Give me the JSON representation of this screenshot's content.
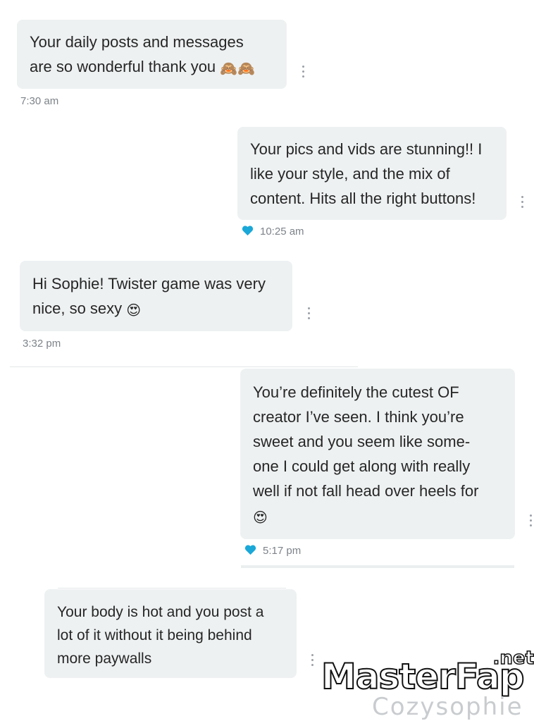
{
  "messages": [
    {
      "id": "m1",
      "direction": "incoming",
      "text": "Your daily posts and messages\nare so wonderful thank you",
      "emoji": "🙈🙈",
      "time": "7:30 am"
    },
    {
      "id": "m2",
      "direction": "outgoing",
      "text": "Your pics and vids are stunning!! I\nlike your style, and the mix of\ncontent. Hits all the right buttons!",
      "emoji": "",
      "time": "10:25 am",
      "liked": true
    },
    {
      "id": "m3",
      "direction": "incoming",
      "text": "Hi Sophie! Twister game was very\nnice, so sexy",
      "emoji": "😍",
      "time": "3:32 pm"
    },
    {
      "id": "m4",
      "direction": "outgoing",
      "text": "You’re definitely the cutest OF\ncreator I’ve seen. I think you’re\nsweet and you seem like some-\none I could get along with really\nwell if not fall head over heels for",
      "emoji": "😍",
      "time": "5:17 pm",
      "liked": true
    },
    {
      "id": "m5",
      "direction": "incoming",
      "text": "Your body is hot and you post a\nlot of it without it being behind\nmore paywalls",
      "emoji": "",
      "time": ""
    }
  ],
  "watermark": {
    "brand_a": "Master",
    "brand_b": "Fap",
    "tld": ".net",
    "sub": "Cozysophie"
  },
  "colors": {
    "bubble": "#eef1f2",
    "time": "#7d8389",
    "heart": "#1aa8d8",
    "menu_dots": "#9aa0a6"
  },
  "icons": [
    "heart-icon",
    "more-vertical-icon"
  ]
}
